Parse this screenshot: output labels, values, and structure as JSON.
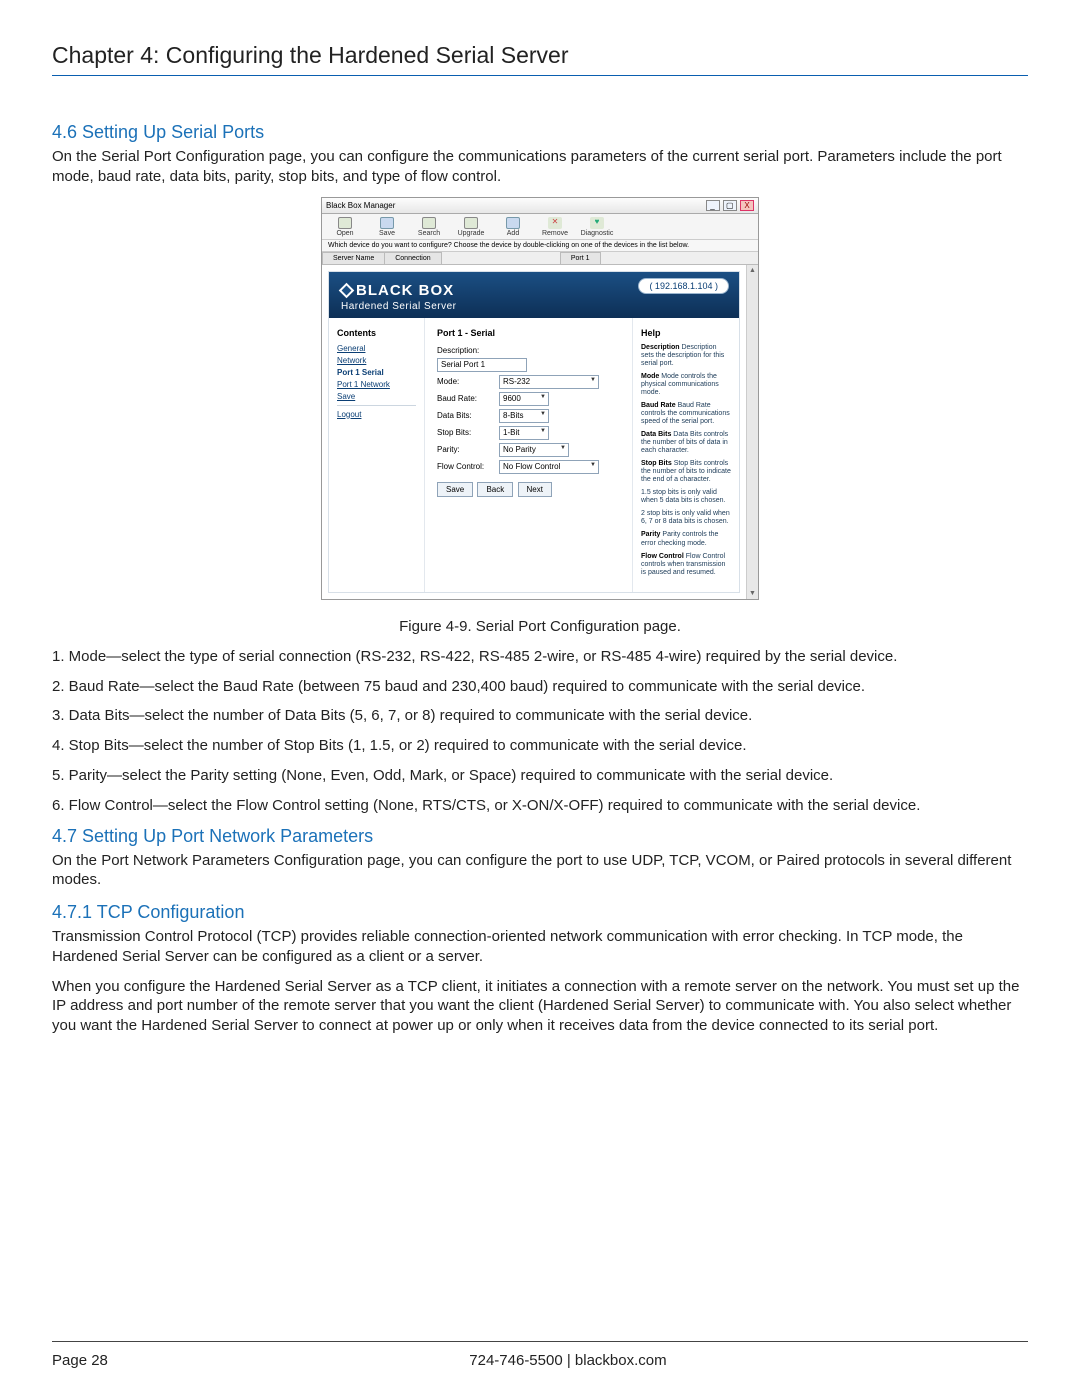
{
  "chapter_title": "Chapter 4: Configuring the Hardened Serial Server",
  "section_46": {
    "heading": "4.6 Setting Up Serial Ports",
    "intro": "On the Serial Port Configuration page, you can configure the communications parameters of the current serial port. Parameters include the port mode, baud rate, data bits, parity, stop bits, and type of flow control."
  },
  "figure_caption": "Figure 4-9. Serial Port Configuration page.",
  "list_items": [
    "1. Mode—select the type of serial connection (RS-232, RS-422, RS-485 2-wire, or RS-485 4-wire) required by the serial device.",
    "2. Baud Rate—select the Baud Rate (between 75 baud and 230,400 baud) required to communicate with the serial device.",
    "3. Data Bits—select the number of Data Bits (5, 6, 7, or 8) required to communicate with the serial device.",
    "4. Stop Bits—select the number of Stop Bits (1, 1.5, or 2) required to communicate with the serial device.",
    "5. Parity—select the Parity setting (None, Even, Odd, Mark, or Space) required to communicate with the serial device.",
    "6. Flow Control—select the Flow Control setting (None, RTS/CTS, or X-ON/X-OFF) required to communicate with the serial device."
  ],
  "section_47": {
    "heading": "4.7 Setting Up Port Network Parameters",
    "intro": "On the Port Network Parameters Configuration page, you can configure the port to use UDP, TCP, VCOM, or Paired protocols in several different modes."
  },
  "section_471": {
    "heading": "4.7.1 TCP Configuration",
    "p1": "Transmission Control Protocol (TCP) provides reliable connection-oriented network communication with error checking. In TCP mode, the Hardened Serial Server can be configured as a client or a server.",
    "p2": "When you configure the Hardened Serial Server as a TCP client, it initiates a connection with a remote server on the network. You must set up the IP address and port number of the remote server that you want the client (Hardened Serial Server) to communicate with. You also select whether you want the Hardened Serial Server to connect at power up or only when it receives data from the device connected to its serial port."
  },
  "footer": {
    "page": "Page 28",
    "center": "724-746-5500   |   blackbox.com"
  },
  "shot": {
    "title": "Black Box Manager",
    "toolbar": [
      "Open",
      "Save",
      "Search",
      "Upgrade",
      "Add",
      "Remove",
      "Diagnostic"
    ],
    "status_line": "Which device do you want to configure? Choose the device by double-clicking on one of the devices in the list below.",
    "tab_server": "Server Name",
    "tab_conn": "Connection",
    "tab_port": "Port 1",
    "brand": "BLACK BOX",
    "brand_sub": "Hardened Serial Server",
    "ip": "( 192.168.1.104 )",
    "contents_heading": "Contents",
    "nav": {
      "general": "General",
      "network": "Network",
      "port1serial": "Port 1 Serial",
      "port1net": "Port 1 Network",
      "save": "Save",
      "logout": "Logout"
    },
    "form_heading": "Port 1 - Serial",
    "labels": {
      "description": "Description:",
      "mode": "Mode:",
      "baud": "Baud Rate:",
      "databits": "Data Bits:",
      "stopbits": "Stop Bits:",
      "parity": "Parity:",
      "flow": "Flow Control:"
    },
    "values": {
      "description": "Serial Port 1",
      "mode": "RS-232",
      "baud": "9600",
      "databits": "8-Bits",
      "stopbits": "1-Bit",
      "parity": "No Parity",
      "flow": "No Flow Control"
    },
    "buttons": {
      "save": "Save",
      "back": "Back",
      "next": "Next"
    },
    "help_heading": "Help",
    "help": {
      "desc": "Description sets the description for this serial port.",
      "mode": "Mode controls the physical communications mode.",
      "baud": "Baud Rate controls the communications speed of the serial port.",
      "databits": "Data Bits controls the number of bits of data in each character.",
      "stopbits": "Stop Bits controls the number of bits to indicate the end of a character.",
      "stop15": "1.5 stop bits is only valid when 5 data bits is chosen.",
      "stop2": "2 stop bits is only valid when 6, 7 or 8 data bits is chosen.",
      "parity": "Parity controls the error checking mode.",
      "flow": "Flow Control controls when transmission is paused and resumed."
    }
  }
}
